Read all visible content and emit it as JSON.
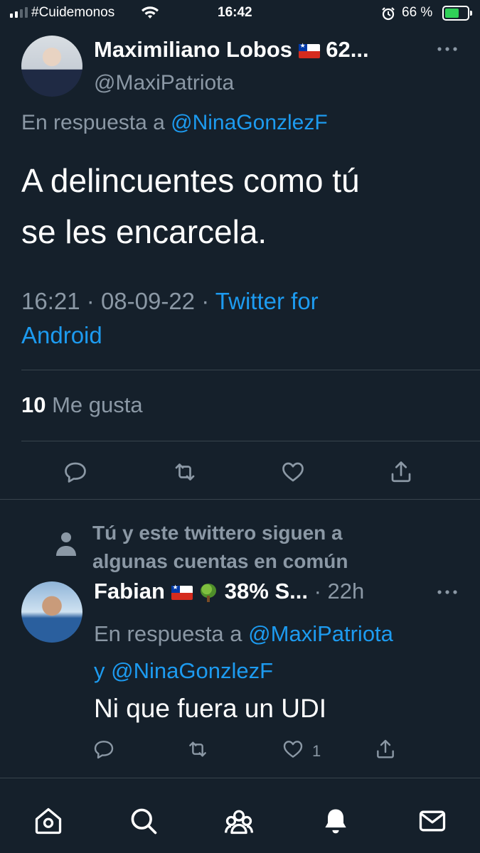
{
  "status_bar": {
    "carrier": "#Cuidemonos",
    "time": "16:42",
    "battery": "66 %"
  },
  "tweet": {
    "author_name": "Maximiliano Lobos",
    "author_suffix": "62...",
    "handle": "@MaxiPatriota",
    "reply_prefix": "En respuesta a",
    "reply_to": "@NinaGonzlezF",
    "text_line1": "A delincuentes como tú",
    "text_line2": "se les encarcela.",
    "time": "16:21",
    "date": "08-09-22",
    "sep": "·",
    "source_line1": "Twitter for",
    "source_line2": "Android",
    "likes_count": "10",
    "likes_label": "Me gusta"
  },
  "social_context": {
    "line1": "Tú y este twittero siguen a",
    "line2": "algunas cuentas en común"
  },
  "reply": {
    "author_name": "Fabian",
    "author_suffix": "38% S...",
    "sep": "·",
    "age": "22h",
    "reply_prefix": "En respuesta a",
    "reply_to_1": "@MaxiPatriota",
    "conj": "y",
    "reply_to_2": "@NinaGonzlezF",
    "text": "Ni que fuera un UDI",
    "like_count": "1"
  },
  "colors": {
    "background": "#15202b",
    "link": "#1d9bf0",
    "muted": "#8b98a5",
    "divider": "#38444d"
  },
  "icons": {
    "more": "more-horizontal-icon",
    "reply": "reply-icon",
    "retweet": "retweet-icon",
    "like": "heart-icon",
    "share": "share-icon",
    "home": "home-icon",
    "search": "search-icon",
    "communities": "communities-icon",
    "notifications": "bell-icon",
    "messages": "mail-icon"
  }
}
